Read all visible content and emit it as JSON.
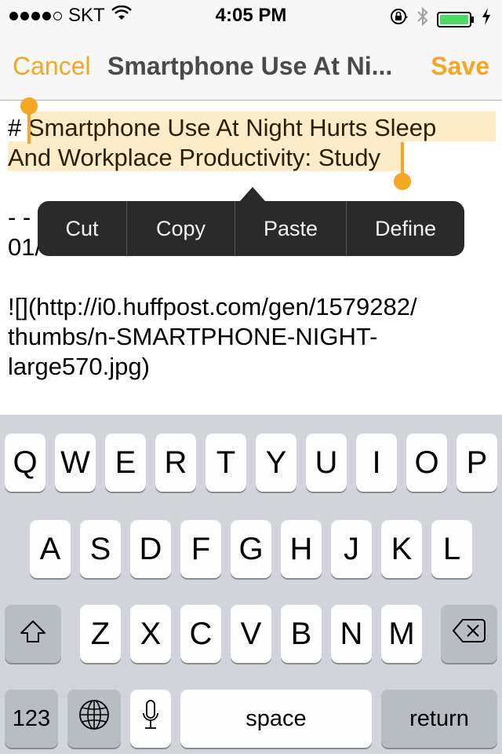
{
  "status_bar": {
    "signal_bars_filled": 4,
    "signal_bars_total": 5,
    "carrier": "SKT",
    "time": "4:05 PM",
    "battery_level_percent": 100,
    "charging": true,
    "icons": [
      "wifi-icon",
      "rotation-lock-icon",
      "bluetooth-icon",
      "battery-icon",
      "charging-bolt-icon"
    ]
  },
  "nav": {
    "cancel_label": "Cancel",
    "title": "Smartphone Use At Ni...",
    "save_label": "Save"
  },
  "editor": {
    "heading_prefix": "# ",
    "selected_line1": "Smartphone Use At Night Hurts Sleep",
    "selected_line2": "And Workplace Productivity: Study",
    "line3": "- -",
    "line4": "01/",
    "image_line1": "![](http://i0.huffpost.com/gen/1579282/",
    "image_line2": "thumbs/n-SMARTPHONE-NIGHT-",
    "image_line3": "large570.jpg)"
  },
  "edit_menu": {
    "items": [
      {
        "label": "Cut"
      },
      {
        "label": "Copy"
      },
      {
        "label": "Paste"
      },
      {
        "label": "Define"
      }
    ]
  },
  "keyboard": {
    "row1": [
      "Q",
      "W",
      "E",
      "R",
      "T",
      "Y",
      "U",
      "I",
      "O",
      "P"
    ],
    "row2": [
      "A",
      "S",
      "D",
      "F",
      "G",
      "H",
      "J",
      "K",
      "L"
    ],
    "row3": [
      "Z",
      "X",
      "C",
      "V",
      "B",
      "N",
      "M"
    ],
    "numbers_label": "123",
    "space_label": "space",
    "return_label": "return"
  }
}
